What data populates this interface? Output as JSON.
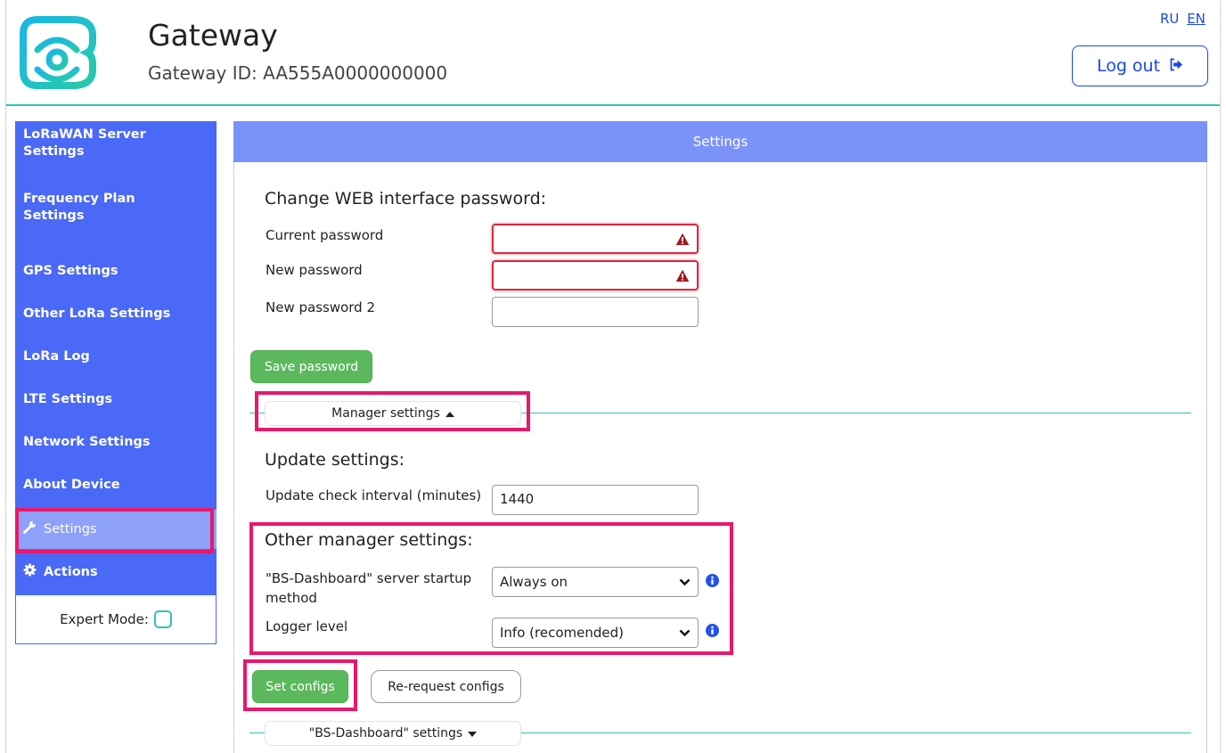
{
  "header": {
    "title": "Gateway",
    "gateway_id": "Gateway ID: AA555A0000000000",
    "languages": [
      "RU",
      "EN"
    ],
    "active_language": "EN",
    "logout_label": "Log out"
  },
  "sidebar": {
    "items": [
      {
        "label": "LoRaWAN Server Settings"
      },
      {
        "label": "Frequency Plan Settings"
      },
      {
        "label": "GPS Settings"
      },
      {
        "label": "Other LoRa Settings"
      },
      {
        "label": "LoRa Log"
      },
      {
        "label": "LTE Settings"
      },
      {
        "label": "Network Settings"
      },
      {
        "label": "About Device"
      },
      {
        "label": "Settings",
        "icon": "wrench-icon",
        "active": true
      },
      {
        "label": "Actions",
        "icon": "gear-icon"
      }
    ],
    "expert_mode_label": "Expert Mode:",
    "expert_mode_checked": false
  },
  "panel": {
    "title": "Settings",
    "password_section": {
      "title": "Change WEB interface password:",
      "current_label": "Current password",
      "new_label": "New password",
      "new2_label": "New password 2",
      "save_label": "Save password"
    },
    "manager_toggle": "Manager settings",
    "update_section": {
      "title": "Update settings:",
      "interval_label": "Update check interval (minutes)",
      "interval_value": "1440"
    },
    "other_section": {
      "title": "Other manager settings:",
      "startup_label": "\"BS-Dashboard\" server startup method",
      "startup_value": "Always on",
      "logger_label": "Logger level",
      "logger_value": "Info (recomended)"
    },
    "set_configs_label": "Set configs",
    "rerequest_label": "Re-request configs",
    "dashboard_toggle": "\"BS-Dashboard\" settings"
  },
  "colors": {
    "sidebar": "#4a69f6",
    "sidebar_active": "#8da1f9",
    "panel_header": "#7b93f9",
    "accent_line": "#2ec4b6",
    "highlight": "#e8186a",
    "button_green": "#5cb85c",
    "link": "#1a47e8",
    "error": "#e0263f"
  }
}
